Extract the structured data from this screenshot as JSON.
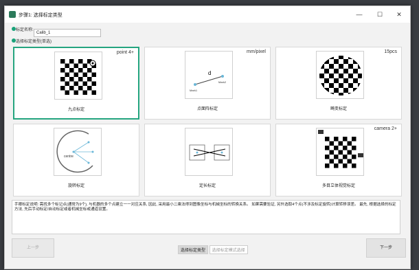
{
  "window": {
    "title": "步骤1: 选择标定类型",
    "minimize": "—",
    "maximize": "☐",
    "close": "✕"
  },
  "form": {
    "name_label": "标定名称:",
    "name_value": "Calib_1",
    "section_label": "选择标定类型(单选)"
  },
  "cards": [
    {
      "label": "九点标定",
      "badge": "point 4+"
    },
    {
      "label": "点面阵标定",
      "badge": "mm/pixel",
      "d": "d",
      "mark1": "Mark1",
      "mark2": "Mark2"
    },
    {
      "label": "畸变标定",
      "badge": "15pcs"
    },
    {
      "label": "旋转标定",
      "centre": "centre"
    },
    {
      "label": "定长标定"
    },
    {
      "label": "多目立体视觉标定",
      "badge": "camera 2+"
    }
  ],
  "description": "手眼标定说明: 需找多个标记点(通常为9个), 与机器的多个点建立一一对应关系, 因此, 采用最小二乘法得到图像坐标与机械坐标的转换关系。 如果需要验证, 另外选取4个点(不涉及标定旋转)计算转移误差。 最先, 根据选择的标定方法, 先后手动标定/自动标定或者机械坐标或通道设置。",
  "buttons": {
    "prev": "上一步",
    "next": "下一步"
  },
  "steps": {
    "step1": "选择标定类型",
    "step2": "选择标定模式选择"
  },
  "colors": {
    "accent": "#24a57f"
  }
}
